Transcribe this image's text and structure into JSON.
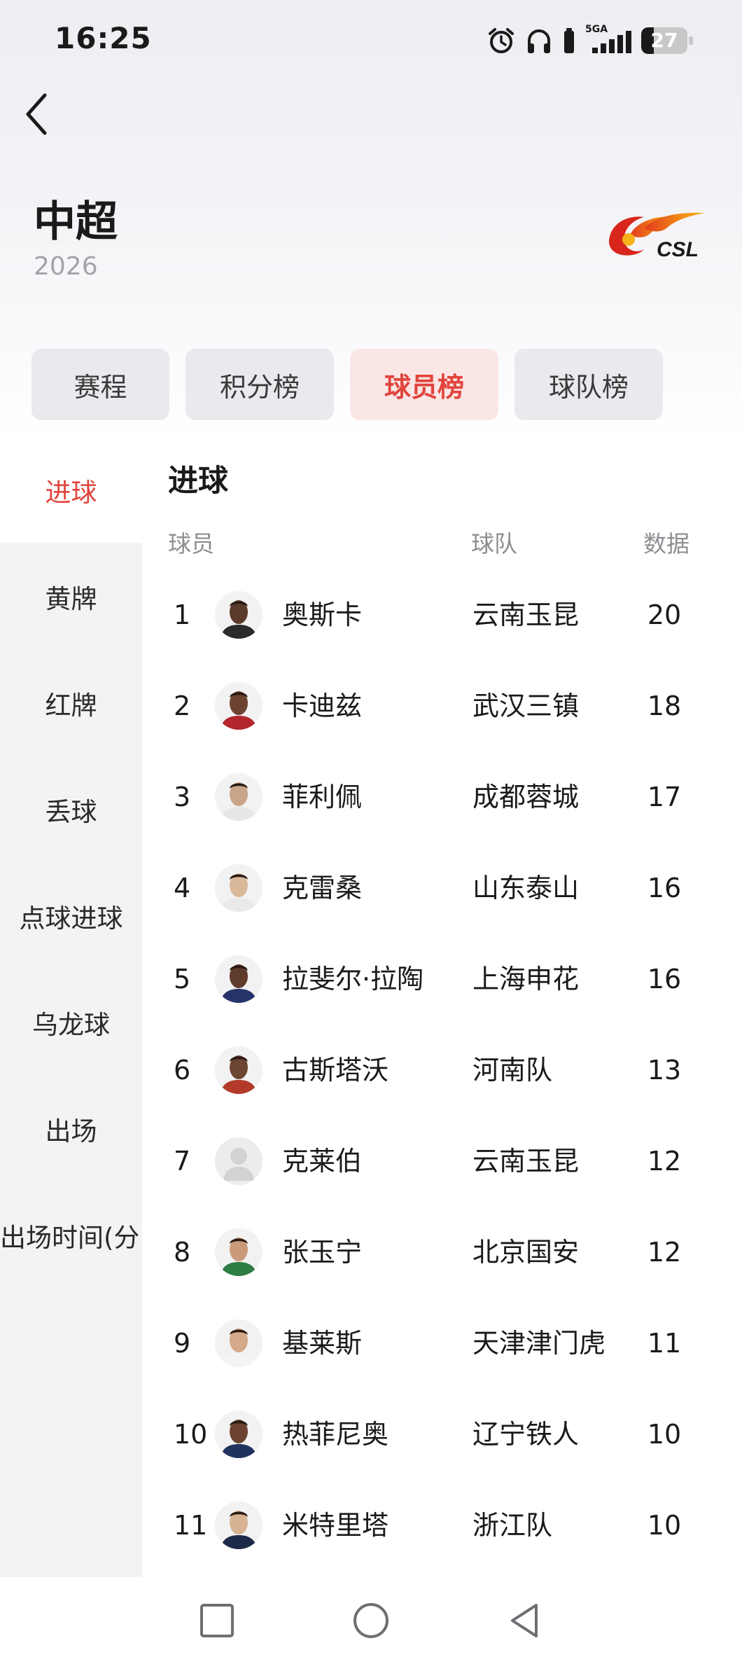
{
  "status_bar": {
    "time": "16:25",
    "network_label": "5GA",
    "battery": "27",
    "battery_level": 0.27
  },
  "header": {
    "title": "中超",
    "season": "2026",
    "logo_text": "CSL"
  },
  "tabs": [
    {
      "label": "赛程",
      "active": false
    },
    {
      "label": "积分榜",
      "active": false
    },
    {
      "label": "球员榜",
      "active": true
    },
    {
      "label": "球队榜",
      "active": false
    }
  ],
  "sidebar": {
    "items": [
      {
        "label": "进球",
        "active": true
      },
      {
        "label": "黄牌",
        "active": false
      },
      {
        "label": "红牌",
        "active": false
      },
      {
        "label": "丢球",
        "active": false
      },
      {
        "label": "点球进球",
        "active": false
      },
      {
        "label": "乌龙球",
        "active": false
      },
      {
        "label": "出场",
        "active": false
      },
      {
        "label": "出场时间(分…",
        "active": false
      }
    ]
  },
  "table": {
    "title": "进球",
    "columns": {
      "player": "球员",
      "team": "球队",
      "stat": "数据"
    },
    "rows": [
      {
        "rank": "1",
        "player": "奥斯卡",
        "team": "云南玉昆",
        "value": "20"
      },
      {
        "rank": "2",
        "player": "卡迪兹",
        "team": "武汉三镇",
        "value": "18"
      },
      {
        "rank": "3",
        "player": "菲利佩",
        "team": "成都蓉城",
        "value": "17"
      },
      {
        "rank": "4",
        "player": "克雷桑",
        "team": "山东泰山",
        "value": "16"
      },
      {
        "rank": "5",
        "player": "拉斐尔·拉陶",
        "team": "上海申花",
        "value": "16"
      },
      {
        "rank": "6",
        "player": "古斯塔沃",
        "team": "河南队",
        "value": "13"
      },
      {
        "rank": "7",
        "player": "克莱伯",
        "team": "云南玉昆",
        "value": "12"
      },
      {
        "rank": "8",
        "player": "张玉宁",
        "team": "北京国安",
        "value": "12"
      },
      {
        "rank": "9",
        "player": "基莱斯",
        "team": "天津津门虎",
        "value": "11"
      },
      {
        "rank": "10",
        "player": "热菲尼奥",
        "team": "辽宁铁人",
        "value": "10"
      },
      {
        "rank": "11",
        "player": "米特里塔",
        "team": "浙江队",
        "value": "10"
      }
    ]
  },
  "colors": {
    "accent": "#e0453d",
    "tab_active_bg": "#fbe6e6",
    "sidebar_bg": "#f3f3f5"
  }
}
